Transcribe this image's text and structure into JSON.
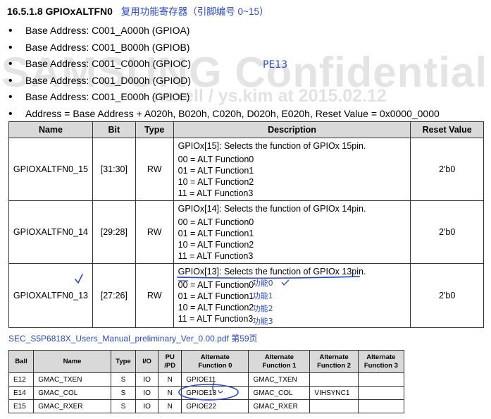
{
  "heading": {
    "section": "16.5.1.8 GPIOxALTFN0",
    "note": "复用功能寄存器（引脚编号 0~15）"
  },
  "watermark": {
    "big": "SAMSUNG Confidential",
    "small": "nexell / ys.kim at 2015.02.12"
  },
  "bullets": [
    "Base Address: C001_A000h (GPIOA)",
    "Base Address: C001_B000h (GPIOB)",
    "Base Address: C001_C000h (GPIOC)",
    "Base Address: C001_D000h (GPIOD)",
    "Base Address: C001_E000h (GPIOE)",
    "Address = Base Address + A020h, B020h, C020h, D020h, E020h, Reset Value = 0x0000_0000"
  ],
  "annotation_pe13": "PE13",
  "register_table": {
    "headers": [
      "Name",
      "Bit",
      "Type",
      "Description",
      "Reset Value"
    ],
    "rows": [
      {
        "name": "GPIOXALTFN0_15",
        "bit": "[31:30]",
        "type": "RW",
        "desc": [
          "GPIOx[15]: Selects the function of GPIOx 15pin.",
          "00 = ALT Function0",
          "01 = ALT Function1",
          "10 = ALT Function2",
          "11 = ALT Function3"
        ],
        "reset": "2'b0"
      },
      {
        "name": "GPIOXALTFN0_14",
        "bit": "[29:28]",
        "type": "RW",
        "desc": [
          "GPIOx[14]: Selects the function of GPIOx 14pin.",
          "00 = ALT Function0",
          "01 = ALT Function1",
          "10 = ALT Function2",
          "11 = ALT Function3"
        ],
        "reset": "2'b0"
      },
      {
        "name": "GPIOXALTFN0_13",
        "bit": "[27:26]",
        "type": "RW",
        "desc": [
          "GPIOx[13]: Selects the function of GPIOx 13pin.",
          "00 = ALT Function0",
          "01 = ALT Function1",
          "10 = ALT Function2",
          "11 = ALT Function3"
        ],
        "reset": "2'b0",
        "notes": [
          "功能0",
          "功能1",
          "功能2",
          "功能3"
        ]
      }
    ]
  },
  "source_link": "SEC_S5P6818X_Users_Manual_preliminary_Ver_0.00.pdf 第59页",
  "pin_table": {
    "headers": [
      "Ball",
      "Name",
      "Type",
      "I/O",
      "PU\n/PD",
      "Alternate\nFunction 0",
      "Alternate\nFunction 1",
      "Alternate\nFunction 2",
      "Alternate\nFunction 3"
    ],
    "rows": [
      [
        "E12",
        "GMAC_TXEN",
        "S",
        "IO",
        "N",
        "GPIOE11",
        "GMAC_TXEN",
        "",
        ""
      ],
      [
        "E14",
        "GMAC_COL",
        "S",
        "IO",
        "N",
        "GPIOE13",
        "GMAC_COL",
        "VIHSYNC1",
        ""
      ],
      [
        "E15",
        "GMAC_RXER",
        "S",
        "IO",
        "N",
        "GPIOE22",
        "GMAC_RXER",
        "",
        ""
      ]
    ]
  },
  "colors": {
    "annotation_blue": "#2a48c8",
    "header_gray": "#d9d9d9"
  }
}
